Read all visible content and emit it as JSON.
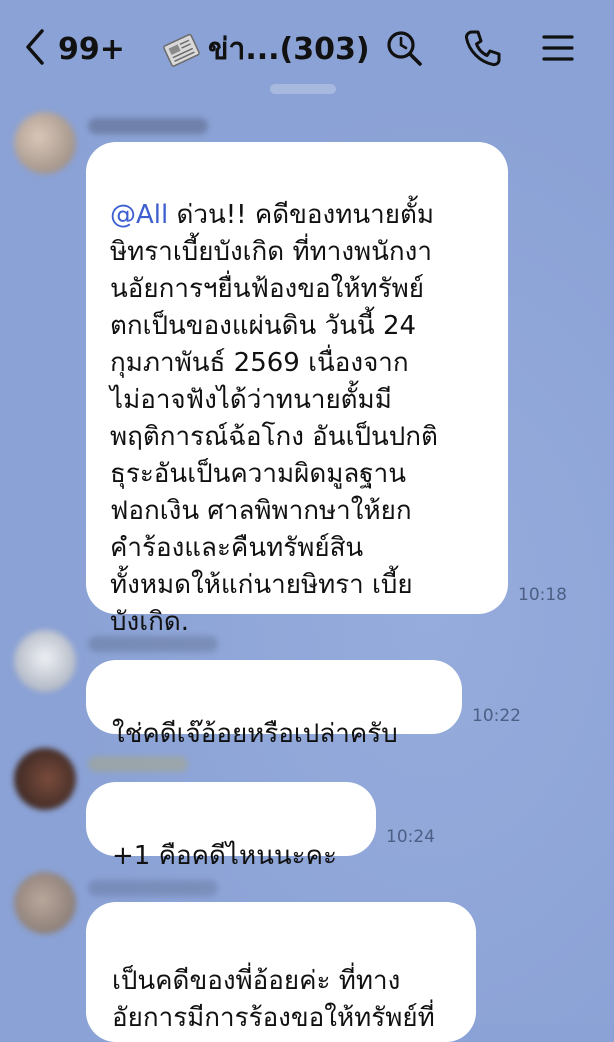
{
  "header": {
    "back_icon": "chevron-left-icon",
    "unread_count": "99+",
    "group_icon": "newspaper-icon",
    "chat_name": "ข่า...(303)",
    "actions": [
      "search-icon",
      "phone-icon",
      "menu-icon"
    ]
  },
  "messages": [
    {
      "mention": "@All",
      "text": " ด่วน!! คดีของทนายตั้ม\nษิทราเบี้ยบังเกิด ที่ทางพนักงา\nนอัยการฯยื่นฟ้องขอให้ทรัพย์\nตกเป็นของแผ่นดิน วันนี้ 24\nกุมภาพันธ์ 2569  เนื่องจาก\nไม่อาจฟังได้ว่าทนายตั้มมี\nพฤติการณ์ฉ้อโกง อันเป็นปกติ\nธุระอันเป็นความผิดมูลฐาน\nฟอกเงิน ศาลพิพากษาให้ยก\nคำร้องและคืนทรัพย์สิน\nทั้งหมดให้แก่นายษิทรา เบี้ย\nบังเกิด.",
      "time": "10:18"
    },
    {
      "text": "ใช่คดีเจ๊อ้อยหรือเปล่าครับ",
      "time": "10:22"
    },
    {
      "text": "+1 คือคดีไหนนะคะ",
      "time": "10:24"
    },
    {
      "text": "เป็นคดีของพี่อ้อยค่ะ ที่ทาง\nอัยการมีการร้องขอให้ทรัพย์ที่",
      "time": ""
    }
  ],
  "colors": {
    "background": "#8ba2d6",
    "bubble": "#ffffff",
    "mention": "#3e5fcf",
    "time": "#4d5f85"
  }
}
